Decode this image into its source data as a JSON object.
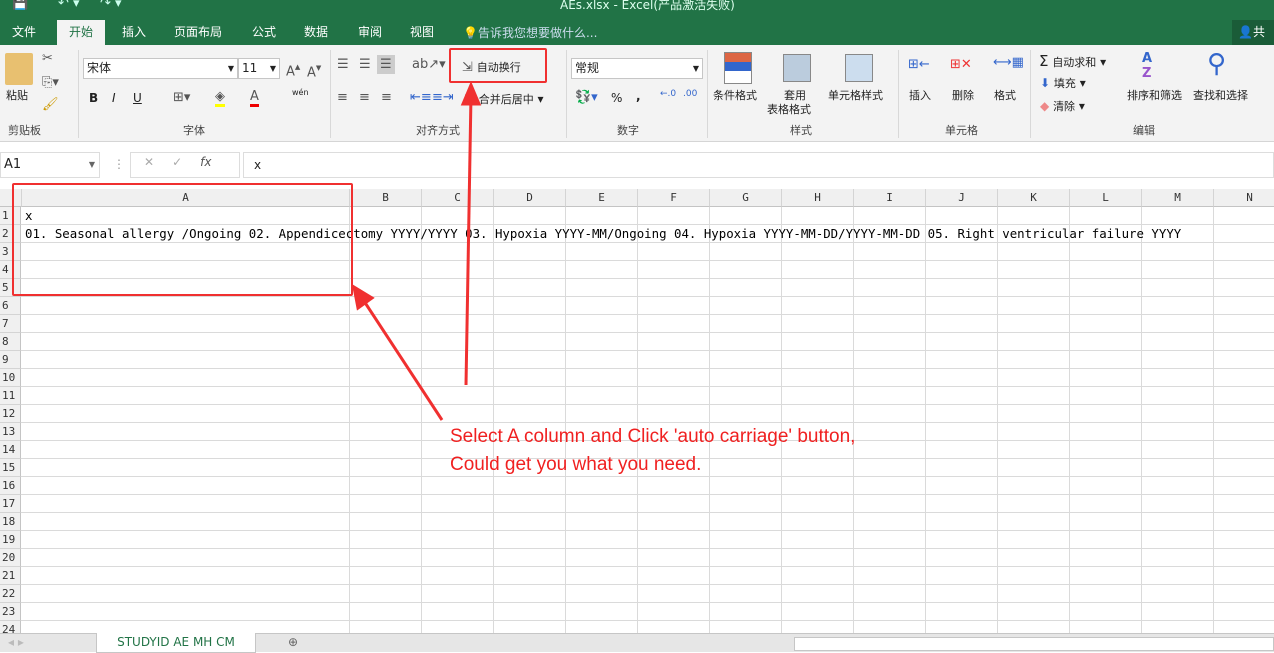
{
  "window": {
    "title": "AEs.xlsx - Excel(产品激活失败)"
  },
  "tabs": [
    "文件",
    "开始",
    "插入",
    "页面布局",
    "公式",
    "数据",
    "审阅",
    "视图"
  ],
  "active_tab": "开始",
  "tell_me": "告诉我您想要做什么...",
  "share": "共享",
  "ribbon": {
    "clipboard": {
      "paste": "粘贴",
      "group": "剪贴板"
    },
    "font": {
      "name": "宋体",
      "size": "11",
      "group": "字体",
      "bold": "B",
      "italic": "I",
      "underline": "U",
      "phonetic": "wén"
    },
    "alignment": {
      "wrap_text": "自动换行",
      "merge_center": "合并后居中",
      "group": "对齐方式"
    },
    "number": {
      "format": "常规",
      "group": "数字",
      "percent": "%",
      "comma": ","
    },
    "styles": {
      "conditional": "条件格式",
      "table_format_1": "套用",
      "table_format_2": "表格格式",
      "cell_styles": "单元格样式",
      "group": "样式"
    },
    "cells": {
      "insert": "插入",
      "delete": "删除",
      "format": "格式",
      "group": "单元格"
    },
    "editing": {
      "autosum": "自动求和",
      "fill": "填充",
      "clear": "清除",
      "sort_filter": "排序和筛选",
      "find_select": "查找和选择",
      "group": "编辑"
    }
  },
  "formula_bar": {
    "name_box": "A1",
    "fx": "fx",
    "value": "x"
  },
  "columns": [
    "A",
    "B",
    "C",
    "D",
    "E",
    "F",
    "G",
    "H",
    "I",
    "J",
    "K",
    "L",
    "M",
    "N"
  ],
  "rows": [
    "1",
    "2",
    "3",
    "4",
    "5",
    "6",
    "7",
    "8",
    "9",
    "10",
    "11",
    "12",
    "13",
    "14",
    "15",
    "16",
    "17",
    "18",
    "19",
    "20",
    "21",
    "22",
    "23",
    "24"
  ],
  "cells": {
    "A1": "x",
    "A2": "01. Seasonal allergy /Ongoing  02. Appendicectomy YYYY/YYYY 03. Hypoxia YYYY-MM/Ongoing  04. Hypoxia YYYY-MM-DD/YYYY-MM-DD  05. Right ventricular failure YYYY"
  },
  "sheet_tabs": [
    "STUDYID AE MH CM"
  ],
  "annotation": {
    "line1": "Select A column and Click 'auto carriage' button,",
    "line2": "Could get you what you need.",
    "color": "#f02020"
  },
  "colors": {
    "excel_green": "#217346"
  }
}
